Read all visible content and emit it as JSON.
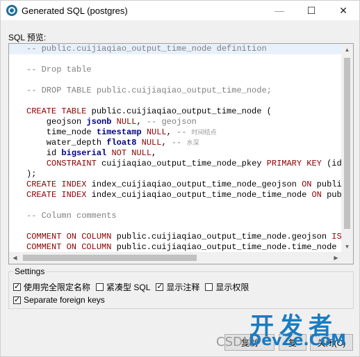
{
  "window": {
    "title": "Generated SQL (postgres)",
    "controls": {
      "minimize": "—",
      "maximize": "☐",
      "close": "✕"
    }
  },
  "preview_label": "SQL 预览:",
  "sql_lines": [
    "-- public.cuijiaqiao_output_time_node definition",
    "",
    "-- Drop table",
    "",
    "-- DROP TABLE public.cuijiaqiao_output_time_node;",
    "",
    "CREATE TABLE public.cuijiaqiao_output_time_node (",
    "    geojson jsonb NULL, -- geojson",
    "    time_node timestamp NULL, -- 时间结点",
    "    water_depth float8 NULL, -- 水深",
    "    id bigserial NOT NULL,",
    "    CONSTRAINT cuijiaqiao_output_time_node_pkey PRIMARY KEY (id)",
    ");",
    "CREATE INDEX index_cuijiaqiao_output_time_node_geojson ON public.",
    "CREATE INDEX index_cuijiaqiao_output_time_node_time_node ON publi",
    "",
    "-- Column comments",
    "",
    "COMMENT ON COLUMN public.cuijiaqiao_output_time_node.geojson IS '",
    "COMMENT ON COLUMN public.cuijiaqiao_output_time_node.time_node IS"
  ],
  "settings": {
    "label": "Settings",
    "options": [
      {
        "label": "使用完全限定名称",
        "checked": true
      },
      {
        "label": "紧凑型 SQL",
        "checked": false
      },
      {
        "label": "显示注释",
        "checked": true
      },
      {
        "label": "显示权限",
        "checked": false
      },
      {
        "label": "Separate foreign keys",
        "checked": true
      }
    ]
  },
  "buttons": {
    "copy": "复制",
    "copy2": "复",
    "close": "关闭(C)"
  },
  "watermark": {
    "main": "开发者",
    "site": "DevZe.CoM",
    "prefix": "CSDN"
  }
}
